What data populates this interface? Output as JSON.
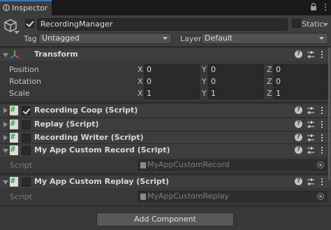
{
  "window": {
    "tab_label": "Inspector"
  },
  "header": {
    "object_name": "RecordingManager",
    "active": true,
    "static_label": "Static",
    "static": false,
    "tag_label": "Tag",
    "tag_value": "Untagged",
    "layer_label": "Layer",
    "layer_value": "Default"
  },
  "transform": {
    "title": "Transform",
    "rows": [
      {
        "label": "Position",
        "x": "0",
        "y": "0",
        "z": "0"
      },
      {
        "label": "Rotation",
        "x": "0",
        "y": "0",
        "z": "0"
      },
      {
        "label": "Scale",
        "x": "1",
        "y": "1",
        "z": "1"
      }
    ],
    "axes": {
      "x": "X",
      "y": "Y",
      "z": "Z"
    }
  },
  "components": [
    {
      "title": "Recording Coop (Script)",
      "enabled": true
    },
    {
      "title": "Replay (Script)",
      "enabled": false
    },
    {
      "title": "Recording Writer (Script)",
      "enabled": false
    },
    {
      "title": "My App Custom Record (Script)",
      "enabled": false,
      "script_label": "Script",
      "script_value": "MyAppCustomRecord"
    },
    {
      "title": "My App Custom Replay (Script)",
      "enabled": false,
      "script_label": "Script",
      "script_value": "MyAppCustomReplay"
    }
  ],
  "help_glyph": "?",
  "add_component_label": "Add Component",
  "icons": {
    "tab": "info-icon",
    "object": "cube-icon",
    "transform": "transform-gizmo-icon",
    "script": "script-icon",
    "help": "help-icon",
    "presets": "sliders-icon",
    "menu": "kebab-menu-icon",
    "lock": "lock-icon",
    "picker": "object-picker-icon"
  },
  "colors": {
    "background": "#383838",
    "header": "#3e3e3e",
    "tab_accent": "#3a79bb",
    "script_green": "#3aa84b"
  }
}
